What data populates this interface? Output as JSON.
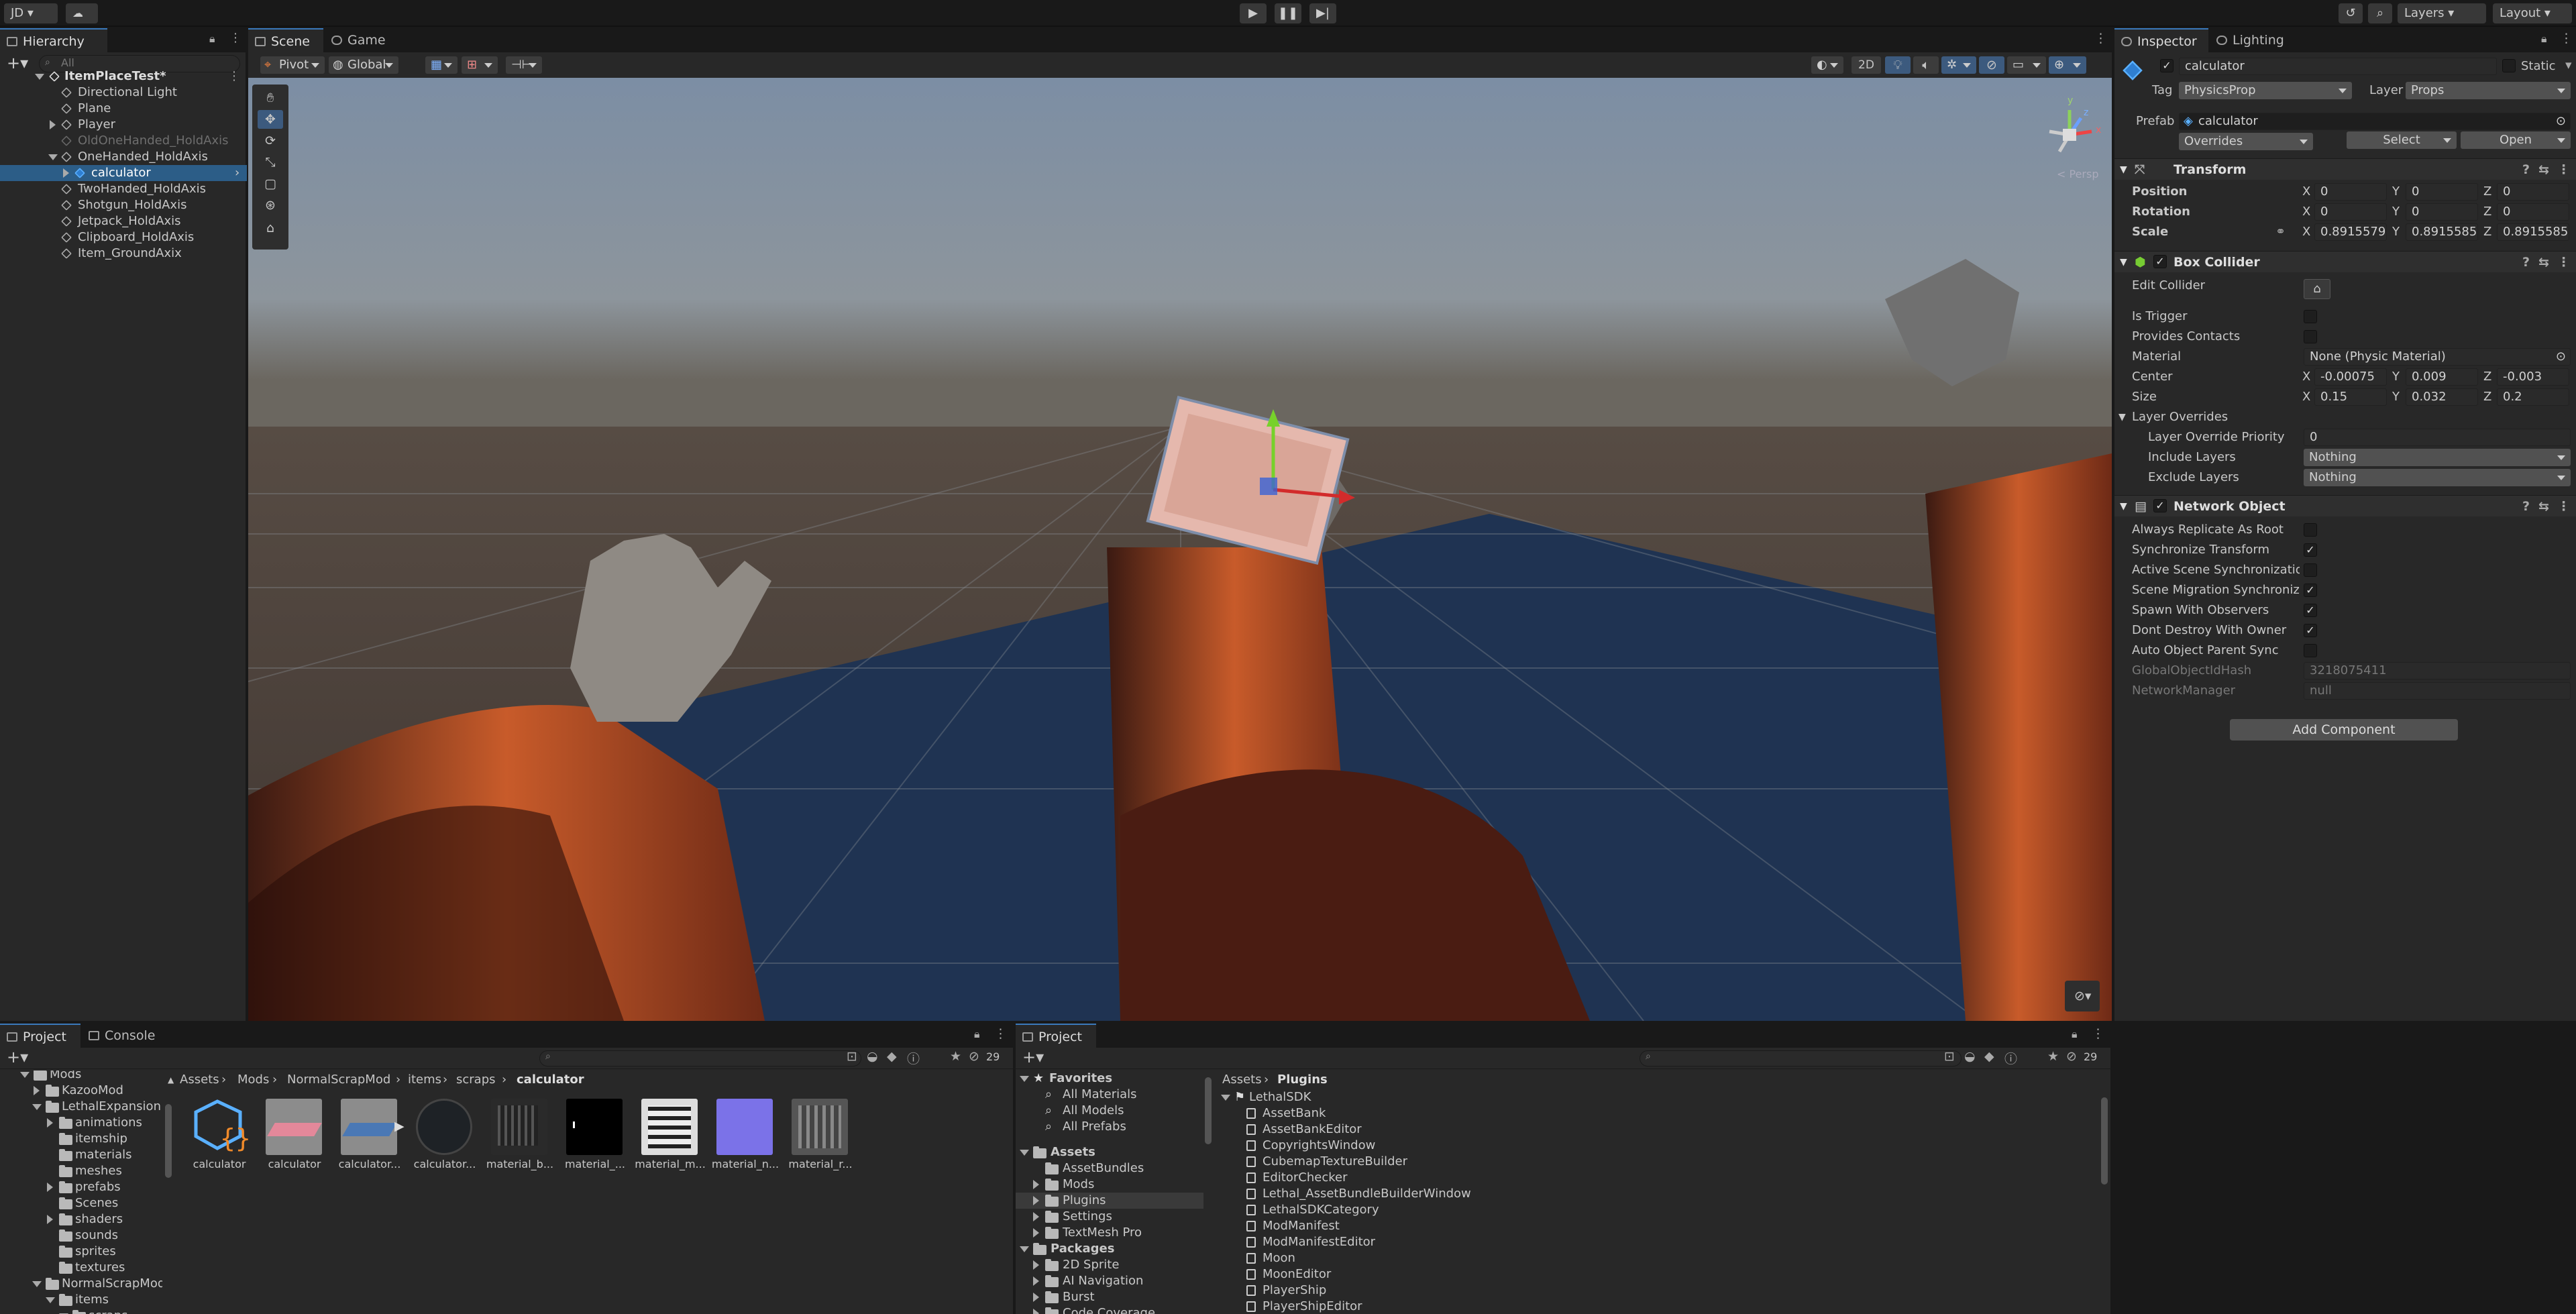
{
  "toolbar": {
    "account": "JD",
    "layers": "Layers",
    "layout": "Layout"
  },
  "hierarchy": {
    "tab": "Hierarchy",
    "search_placeholder": "All",
    "scene": "ItemPlaceTest*",
    "items": [
      {
        "label": "Directional Light"
      },
      {
        "label": "Plane"
      },
      {
        "label": "Player"
      },
      {
        "label": "OldOneHanded_HoldAxis"
      },
      {
        "label": "OneHanded_HoldAxis"
      },
      {
        "label": "calculator"
      },
      {
        "label": "TwoHanded_HoldAxis"
      },
      {
        "label": "Shotgun_HoldAxis"
      },
      {
        "label": "Jetpack_HoldAxis"
      },
      {
        "label": "Clipboard_HoldAxis"
      },
      {
        "label": "Item_GroundAxix"
      }
    ]
  },
  "scene_view": {
    "tabs": [
      "Scene",
      "Game"
    ],
    "pivot": "Pivot",
    "global": "Global",
    "mode_2d": "2D",
    "persp": "< Persp",
    "gizmo_axes": [
      "y",
      "x",
      "z"
    ]
  },
  "inspector": {
    "tabs": [
      "Inspector",
      "Lighting"
    ],
    "object_name": "calculator",
    "static_label": "Static",
    "tag_label": "Tag",
    "tag": "PhysicsProp",
    "layer_label": "Layer",
    "layer": "Props",
    "prefab_label": "Prefab",
    "prefab": "calculator",
    "overrides": "Overrides",
    "select": "Select",
    "open": "Open",
    "transform": {
      "title": "Transform",
      "position_label": "Position",
      "rotation_label": "Rotation",
      "scale_label": "Scale",
      "position": [
        "0",
        "0",
        "0"
      ],
      "rotation": [
        "0",
        "0",
        "0"
      ],
      "scale": [
        "0.8915579",
        "0.8915585",
        "0.8915585"
      ]
    },
    "box_collider": {
      "title": "Box Collider",
      "edit_collider": "Edit Collider",
      "is_trigger": "Is Trigger",
      "provides_contacts": "Provides Contacts",
      "material_label": "Material",
      "material": "None (Physic Material)",
      "center_label": "Center",
      "center": [
        "-0.00075",
        "0.009",
        "-0.003"
      ],
      "size_label": "Size",
      "size": [
        "0.15",
        "0.032",
        "0.2"
      ],
      "layer_overrides": "Layer Overrides",
      "priority_label": "Layer Override Priority",
      "priority": "0",
      "include_label": "Include Layers",
      "include": "Nothing",
      "exclude_label": "Exclude Layers",
      "exclude": "Nothing"
    },
    "network_object": {
      "title": "Network Object",
      "rows": [
        {
          "label": "Always Replicate As Root",
          "checked": false
        },
        {
          "label": "Synchronize Transform",
          "checked": true
        },
        {
          "label": "Active Scene Synchronizatio",
          "checked": false
        },
        {
          "label": "Scene Migration Synchroniza",
          "checked": true
        },
        {
          "label": "Spawn With Observers",
          "checked": true
        },
        {
          "label": "Dont Destroy With Owner",
          "checked": true
        },
        {
          "label": "Auto Object Parent Sync",
          "checked": false
        }
      ],
      "hash_label": "GlobalObjectIdHash",
      "hash": "3218075411",
      "manager_label": "NetworkManager",
      "manager": "null"
    },
    "add_component": "Add Component"
  },
  "project_left": {
    "tabs": [
      "Project",
      "Console"
    ],
    "hidden_count": "29",
    "breadcrumb": [
      "Assets",
      "Mods",
      "NormalScrapMod",
      "items",
      "scraps",
      "calculator"
    ],
    "tree": [
      {
        "label": "Mods"
      },
      {
        "label": "KazooMod"
      },
      {
        "label": "LethalExpansion"
      },
      {
        "label": "animations"
      },
      {
        "label": "itemship"
      },
      {
        "label": "materials"
      },
      {
        "label": "meshes"
      },
      {
        "label": "prefabs"
      },
      {
        "label": "Scenes"
      },
      {
        "label": "shaders"
      },
      {
        "label": "sounds"
      },
      {
        "label": "sprites"
      },
      {
        "label": "textures"
      },
      {
        "label": "NormalScrapMod"
      },
      {
        "label": "items"
      },
      {
        "label": "scraps"
      }
    ],
    "assets": [
      {
        "label": "calculator"
      },
      {
        "label": "calculator"
      },
      {
        "label": "calculator..."
      },
      {
        "label": "calculator..."
      },
      {
        "label": "material_b..."
      },
      {
        "label": "material_..."
      },
      {
        "label": "material_m..."
      },
      {
        "label": "material_n..."
      },
      {
        "label": "material_r..."
      }
    ]
  },
  "project_right": {
    "tab": "Project",
    "hidden_count": "29",
    "breadcrumb": [
      "Assets",
      "Plugins"
    ],
    "favorites": "Favorites",
    "fav_items": [
      "All Materials",
      "All Models",
      "All Prefabs"
    ],
    "assets_label": "Assets",
    "asset_folders": [
      "AssetBundles",
      "Mods",
      "Plugins",
      "Settings",
      "TextMesh Pro"
    ],
    "packages_label": "Packages",
    "package_folders": [
      "2D Sprite",
      "AI Navigation",
      "Burst",
      "Code Coverage"
    ],
    "root": "LethalSDK",
    "files": [
      "AssetBank",
      "AssetBankEditor",
      "CopyrightsWindow",
      "CubemapTextureBuilder",
      "EditorChecker",
      "Lethal_AssetBundleBuilderWindow",
      "LethalSDKCategory",
      "ModManifest",
      "ModManifestEditor",
      "Moon",
      "MoonEditor",
      "PlayerShip",
      "PlayerShipEditor"
    ]
  }
}
